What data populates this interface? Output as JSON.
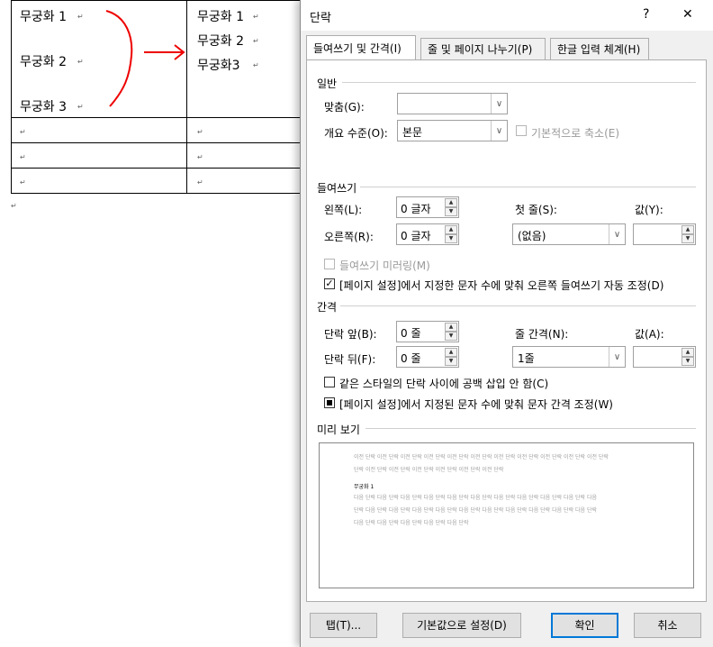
{
  "document": {
    "left_cells": [
      "무궁화 1",
      "무궁화 2",
      "무궁화 3"
    ],
    "right_cells": [
      "무궁화 1",
      "무궁화 2",
      "무궁화3"
    ],
    "para_mark": "↵"
  },
  "dialog": {
    "title": "단락",
    "help": "?",
    "close": "✕",
    "tabs": [
      "들여쓰기 및 간격(I)",
      "줄 및 페이지 나누기(P)",
      "한글 입력 체계(H)"
    ],
    "general": {
      "section": "일반",
      "alignment_label": "맞춤(G):",
      "alignment_value": "",
      "outline_label": "개요 수준(O):",
      "outline_value": "본문",
      "collapsed_label": "기본적으로 축소(E)"
    },
    "indent": {
      "section": "들여쓰기",
      "left_label": "왼쪽(L):",
      "left_value": "0 글자",
      "right_label": "오른쪽(R):",
      "right_value": "0 글자",
      "first_line_label": "첫 줄(S):",
      "first_line_value": "(없음)",
      "by_label": "값(Y):",
      "by_value": "",
      "mirror_label": "들여쓰기 미러링(M)",
      "auto_adjust_label": "[페이지 설정]에서 지정한 문자 수에 맞춰 오른쪽 들여쓰기 자동 조정(D)"
    },
    "spacing": {
      "section": "간격",
      "before_label": "단락 앞(B):",
      "before_value": "0 줄",
      "after_label": "단락 뒤(F):",
      "after_value": "0 줄",
      "line_spacing_label": "줄 간격(N):",
      "line_spacing_value": "1줄",
      "at_label": "값(A):",
      "at_value": "",
      "no_space_same_style_label": "같은 스타일의 단락 사이에 공백 삽입 안 함(C)",
      "snap_grid_label": "[페이지 설정]에서 지정된 문자 수에 맞춰 문자 간격 조정(W)"
    },
    "preview": {
      "section": "미리 보기",
      "prev_lines": [
        "이전 단락 이전 단락 이전 단락 이전 단락 이전 단락 이전 단락 이전 단락 이전 단락 이전 단락 이전 단락 이전 단락",
        "단락 이전 단락 이전 단락 이전 단락 이전 단락 이전 단락 이전 단락"
      ],
      "current": "무궁화 1",
      "next_lines": [
        "다음 단락 다음 단락 다음 단락 다음 단락 다음 단락 다음 단락 다음 단락 다음 단락 다음 단락 다음 단락 다음",
        "단락 다음 단락 다음 단락 다음 단락 다음 단락 다음 단락 다음 단락 다음 단락 다음 단락 다음 단락 다음 단락",
        "다음 단락 다음 단락 다음 단락 다음 단락 다음 단락"
      ]
    },
    "buttons": {
      "tabs": "탭(T)...",
      "set_default": "기본값으로 설정(D)",
      "ok": "확인",
      "cancel": "취소"
    }
  }
}
